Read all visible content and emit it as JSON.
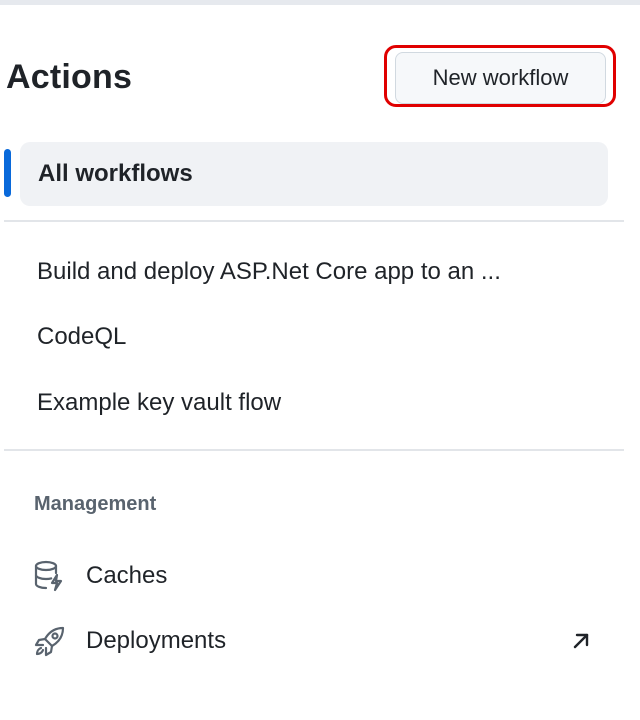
{
  "header": {
    "title": "Actions",
    "new_workflow_label": "New workflow"
  },
  "nav": {
    "all_workflows_label": "All workflows"
  },
  "workflows": [
    {
      "label": "Build and deploy ASP.Net Core app to an ..."
    },
    {
      "label": "CodeQL"
    },
    {
      "label": "Example key vault flow"
    }
  ],
  "management": {
    "heading": "Management",
    "items": [
      {
        "label": "Caches",
        "icon": "database-icon"
      },
      {
        "label": "Deployments",
        "icon": "rocket-icon",
        "external_icon": "arrow-up-right-icon"
      }
    ]
  },
  "colors": {
    "accent": "#0969da",
    "highlight": "#e00000",
    "selected_bg": "#f0f2f5",
    "button_bg": "#f6f8fa"
  }
}
